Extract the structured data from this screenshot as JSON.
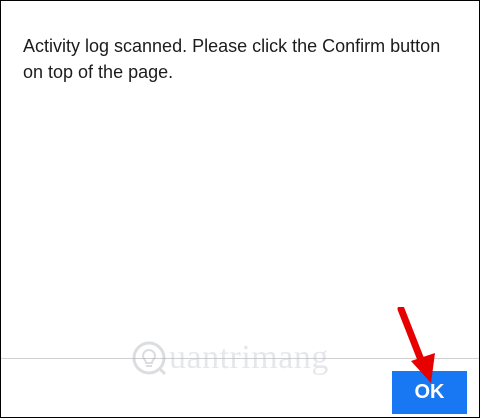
{
  "dialog": {
    "message": "Activity log scanned. Please click the Confirm button on top of the page.",
    "ok_label": "OK"
  },
  "watermark": {
    "text": "uantrimang"
  },
  "colors": {
    "button_bg": "#1877f2",
    "arrow": "#e60000"
  },
  "icons": {
    "arrow": "red-pointer-arrow-icon",
    "watermark_logo": "quantrimang-logo"
  }
}
